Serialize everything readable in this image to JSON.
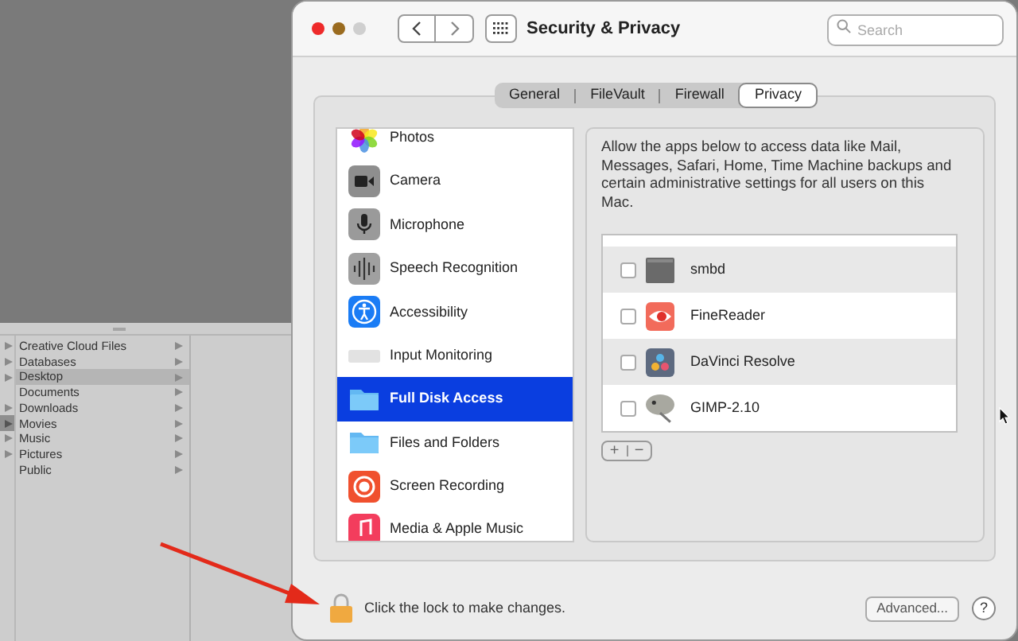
{
  "background_window": {
    "left_column_rows": [
      {
        "has_arrow": true,
        "selected": false
      },
      {
        "has_arrow": true,
        "selected": false
      },
      {
        "has_arrow": true,
        "selected": false
      },
      {
        "has_arrow": false,
        "selected": false
      },
      {
        "has_arrow": true,
        "selected": false
      },
      {
        "has_arrow": true,
        "selected": true
      },
      {
        "has_arrow": true,
        "selected": false
      },
      {
        "has_arrow": true,
        "selected": false
      }
    ],
    "items": [
      {
        "label": "Creative Cloud Files",
        "selected": false
      },
      {
        "label": "Databases",
        "selected": false
      },
      {
        "label": "Desktop",
        "selected": true
      },
      {
        "label": "Documents",
        "selected": false
      },
      {
        "label": "Downloads",
        "selected": false
      },
      {
        "label": "Movies",
        "selected": false
      },
      {
        "label": "Music",
        "selected": false
      },
      {
        "label": "Pictures",
        "selected": false
      },
      {
        "label": "Public",
        "selected": false
      }
    ]
  },
  "window": {
    "title": "Security & Privacy",
    "search": {
      "placeholder": "Search"
    }
  },
  "tabs": [
    {
      "label": "General",
      "selected": false
    },
    {
      "label": "FileVault",
      "selected": false
    },
    {
      "label": "Firewall",
      "selected": false
    },
    {
      "label": "Privacy",
      "selected": true
    }
  ],
  "categories": [
    {
      "label": "Photos",
      "kind": "photos",
      "selected": false
    },
    {
      "label": "Camera",
      "kind": "camera",
      "selected": false
    },
    {
      "label": "Microphone",
      "kind": "microphone",
      "selected": false
    },
    {
      "label": "Speech Recognition",
      "kind": "speech",
      "selected": false
    },
    {
      "label": "Accessibility",
      "kind": "accessibility",
      "selected": false
    },
    {
      "label": "Input Monitoring",
      "kind": "keyboard",
      "selected": false
    },
    {
      "label": "Full Disk Access",
      "kind": "folder",
      "selected": true
    },
    {
      "label": "Files and Folders",
      "kind": "folder",
      "selected": false
    },
    {
      "label": "Screen Recording",
      "kind": "record",
      "selected": false
    },
    {
      "label": "Media & Apple Music",
      "kind": "music",
      "selected": false
    }
  ],
  "description": "Allow the apps below to access data like Mail, Messages, Safari, Home, Time Machine backups and certain administrative settings for all users on this Mac.",
  "apps": [
    {
      "name": "smbd",
      "kind": "terminal",
      "checked": false
    },
    {
      "name": "FineReader",
      "kind": "finereader",
      "checked": false
    },
    {
      "name": "DaVinci Resolve",
      "kind": "davinci",
      "checked": false
    },
    {
      "name": "GIMP-2.10",
      "kind": "gimp",
      "checked": false
    }
  ],
  "add_remove": {
    "add": "+",
    "remove": "−"
  },
  "footer": {
    "lock_text": "Click the lock to make changes.",
    "advanced": "Advanced...",
    "help": "?"
  }
}
